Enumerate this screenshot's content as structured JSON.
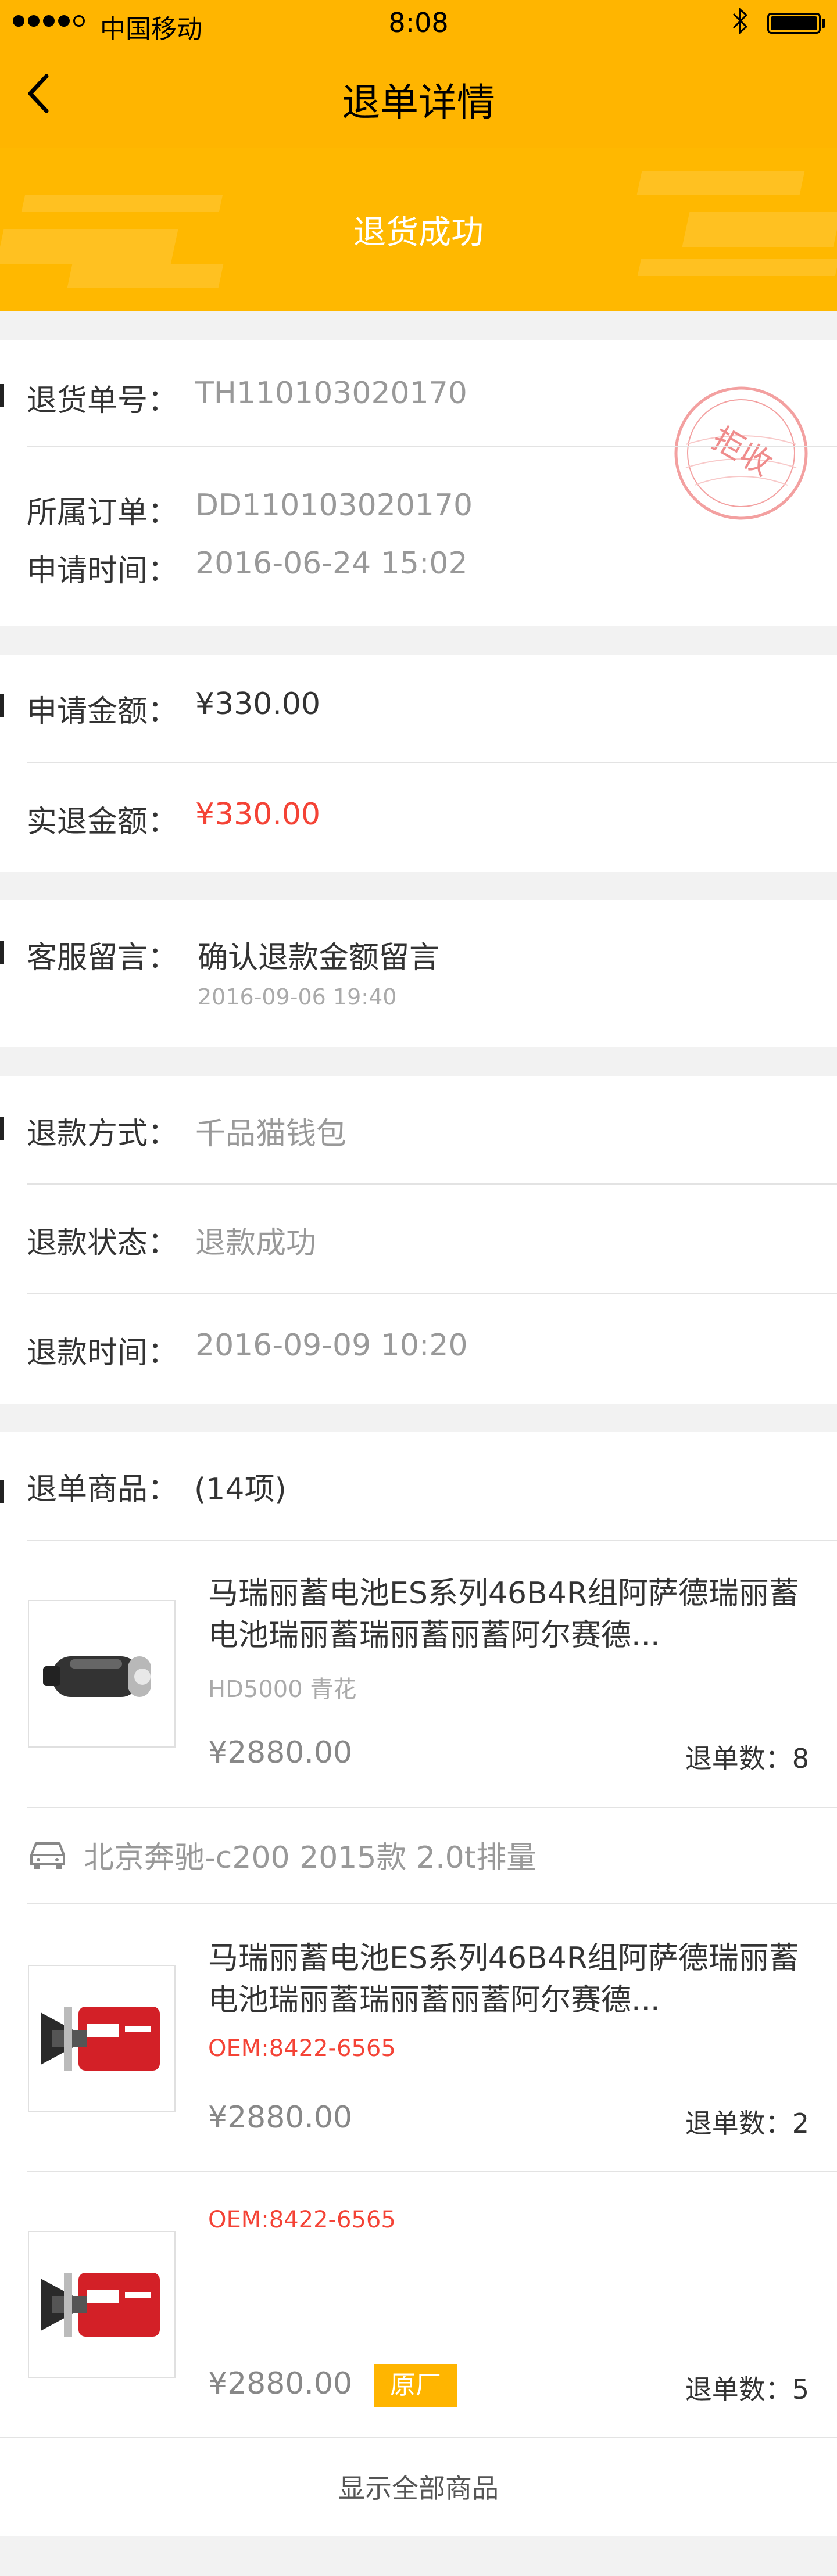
{
  "status_bar": {
    "carrier": "中国移动",
    "time": "8:08"
  },
  "nav": {
    "title": "退单详情"
  },
  "banner": {
    "text": "退货成功"
  },
  "order_info": {
    "return_no_label": "退货单号：",
    "return_no": "TH110103020170",
    "stamp_text": "拒收",
    "order_label": "所属订单：",
    "order_no": "DD110103020170",
    "apply_time_label": "申请时间：",
    "apply_time": "2016-06-24   15:02"
  },
  "amounts": {
    "apply_label": "申请金额：",
    "apply_amount": "¥330.00",
    "actual_label": "实退金额：",
    "actual_amount": "¥330.00"
  },
  "service_msg": {
    "label": "客服留言：",
    "message": "确认退款金额留言",
    "time": "2016-09-06 19:40"
  },
  "refund": {
    "method_label": "退款方式：",
    "method": "千品猫钱包",
    "status_label": "退款状态：",
    "status": "退款成功",
    "time_label": "退款时间：",
    "time": "2016-09-09 10:20"
  },
  "goods": {
    "label": "退单商品：",
    "count": "(14项)",
    "items": [
      {
        "name": "马瑞丽蓄电池ES系列46B4R组阿萨德瑞丽蓄电池瑞丽蓄瑞丽蓄丽蓄阿尔赛德...",
        "spec": "HD5000   青花",
        "price": "¥2880.00",
        "qty": "退单数：8"
      },
      {
        "name": "马瑞丽蓄电池ES系列46B4R组阿萨德瑞丽蓄电池瑞丽蓄瑞丽蓄丽蓄阿尔赛德...",
        "oem": "OEM:8422-6565",
        "price": "¥2880.00",
        "qty": "退单数：2"
      },
      {
        "oem": "OEM:8422-6565",
        "price": "¥2880.00",
        "badge": "原厂",
        "qty": "退单数：5"
      }
    ],
    "car_model": "北京奔驰-c200 2015款 2.0t排量",
    "show_all": "显示全部商品"
  },
  "colors": {
    "brand": "#ffb500",
    "accent_red": "#f44336"
  }
}
